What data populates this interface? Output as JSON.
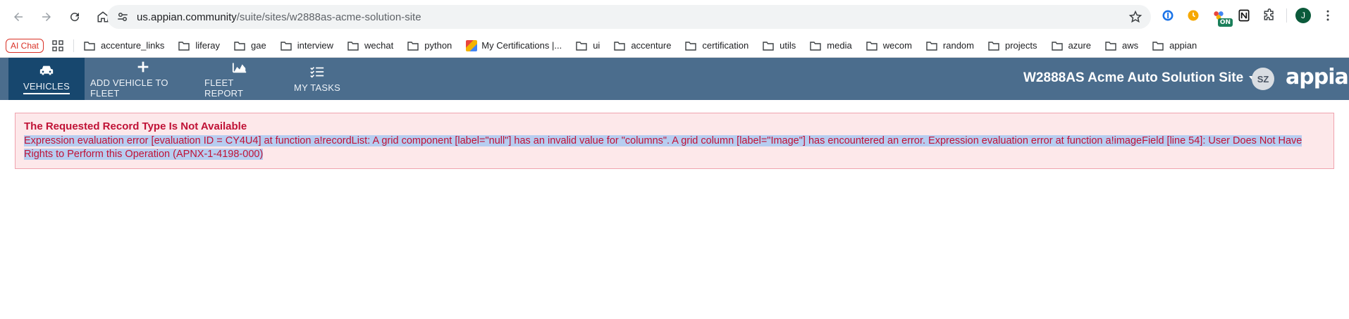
{
  "browser": {
    "url_host": "us.appian.community",
    "url_path": "/suite/sites/w2888as-acme-solution-site",
    "avatar_letter": "J",
    "ext_badge": "ON"
  },
  "bookmarks": {
    "ai_chat": "AI Chat",
    "items": [
      {
        "label": "accenture_links",
        "type": "folder"
      },
      {
        "label": "liferay",
        "type": "folder"
      },
      {
        "label": "gae",
        "type": "folder"
      },
      {
        "label": "interview",
        "type": "folder"
      },
      {
        "label": "wechat",
        "type": "folder"
      },
      {
        "label": "python",
        "type": "folder"
      },
      {
        "label": "My Certifications |...",
        "type": "page"
      },
      {
        "label": "ui",
        "type": "folder"
      },
      {
        "label": "accenture",
        "type": "folder"
      },
      {
        "label": "certification",
        "type": "folder"
      },
      {
        "label": "utils",
        "type": "folder"
      },
      {
        "label": "media",
        "type": "folder"
      },
      {
        "label": "wecom",
        "type": "folder"
      },
      {
        "label": "random",
        "type": "folder"
      },
      {
        "label": "projects",
        "type": "folder"
      },
      {
        "label": "azure",
        "type": "folder"
      },
      {
        "label": "aws",
        "type": "folder"
      },
      {
        "label": "appian",
        "type": "folder"
      }
    ]
  },
  "app": {
    "nav": [
      {
        "label": "VEHICLES",
        "icon": "car-icon",
        "active": true
      },
      {
        "label": "ADD VEHICLE TO FLEET",
        "icon": "plus-icon",
        "active": false
      },
      {
        "label": "FLEET REPORT",
        "icon": "area-chart-icon",
        "active": false
      },
      {
        "label": "MY TASKS",
        "icon": "task-list-icon",
        "active": false
      }
    ],
    "site_name": "W2888AS Acme Auto Solution Site",
    "user_initials": "SZ",
    "logo_text": "appian",
    "header_color": "#4b6d8d",
    "active_nav_color": "#17476e"
  },
  "error": {
    "title": "The Requested Record Type Is Not Available",
    "message": "Expression evaluation error [evaluation ID = CY4U4] at function a!recordList: A grid component [label=\"null\"] has an invalid value for \"columns\". A grid column [label=\"Image\"] has encountered an error. Expression evaluation error at function a!imageField [line 54]: User Does Not Have Rights to Perform this Operation (APNX-1-4198-000)",
    "text_color": "#c01236",
    "bg_color": "#fde8ea"
  }
}
